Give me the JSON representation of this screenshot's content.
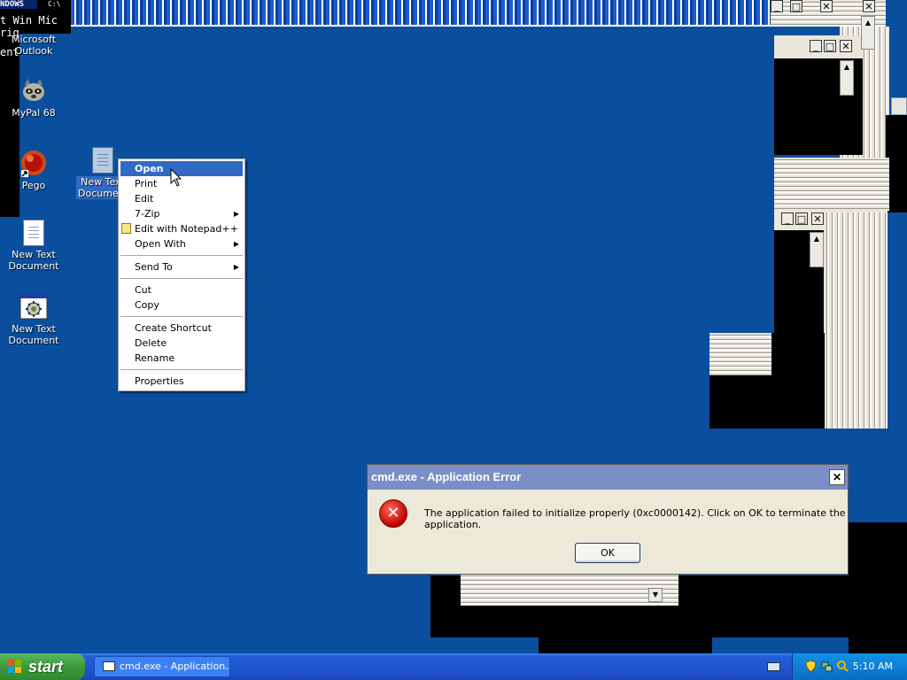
{
  "desktop": {
    "background_color": "#0a4f9e",
    "icons": [
      {
        "label": "Microsoft Outlook",
        "icon": "outlook-icon"
      },
      {
        "label": "MyPal 68",
        "icon": "mypal-raccoon-icon"
      },
      {
        "label": "Pego",
        "icon": "pego-orb-icon"
      },
      {
        "label": "New Text Document",
        "icon": "text-document-icon"
      },
      {
        "label": "New Text Document",
        "icon": "text-document-icon"
      },
      {
        "label": "New Text Document",
        "icon": "batch-file-gear-icon"
      }
    ],
    "glitch_text": {
      "line1": "NDOWS",
      "line2": "t Win Mic",
      "line3": "rig",
      "line4": "ent"
    }
  },
  "context_menu": {
    "items": [
      {
        "label": "Open",
        "highlighted": true
      },
      {
        "label": "Print"
      },
      {
        "label": "Edit"
      },
      {
        "label": "7-Zip",
        "submenu": true
      },
      {
        "label": "Edit with Notepad++",
        "icon": "notepad-plus-plus-icon"
      },
      {
        "label": "Open With",
        "submenu": true
      },
      {
        "label": "Send To",
        "submenu": true
      },
      {
        "label": "Cut"
      },
      {
        "label": "Copy"
      },
      {
        "label": "Create Shortcut"
      },
      {
        "label": "Delete"
      },
      {
        "label": "Rename"
      },
      {
        "label": "Properties"
      }
    ]
  },
  "dialog": {
    "title": "cmd.exe - Application Error",
    "close_label": "✕",
    "icon": "error-icon",
    "message": "The application failed to initialize properly (0xc0000142). Click on OK to terminate the application.",
    "ok_label": "OK",
    "title_color": "#7b8fc6"
  },
  "window_controls": {
    "minimize": "_",
    "maximize": "□",
    "close": "✕"
  },
  "taskbar": {
    "start_label": "start",
    "task_button_label": "cmd.exe - Application...",
    "clock": "5:10 AM",
    "color": "#245edb"
  }
}
